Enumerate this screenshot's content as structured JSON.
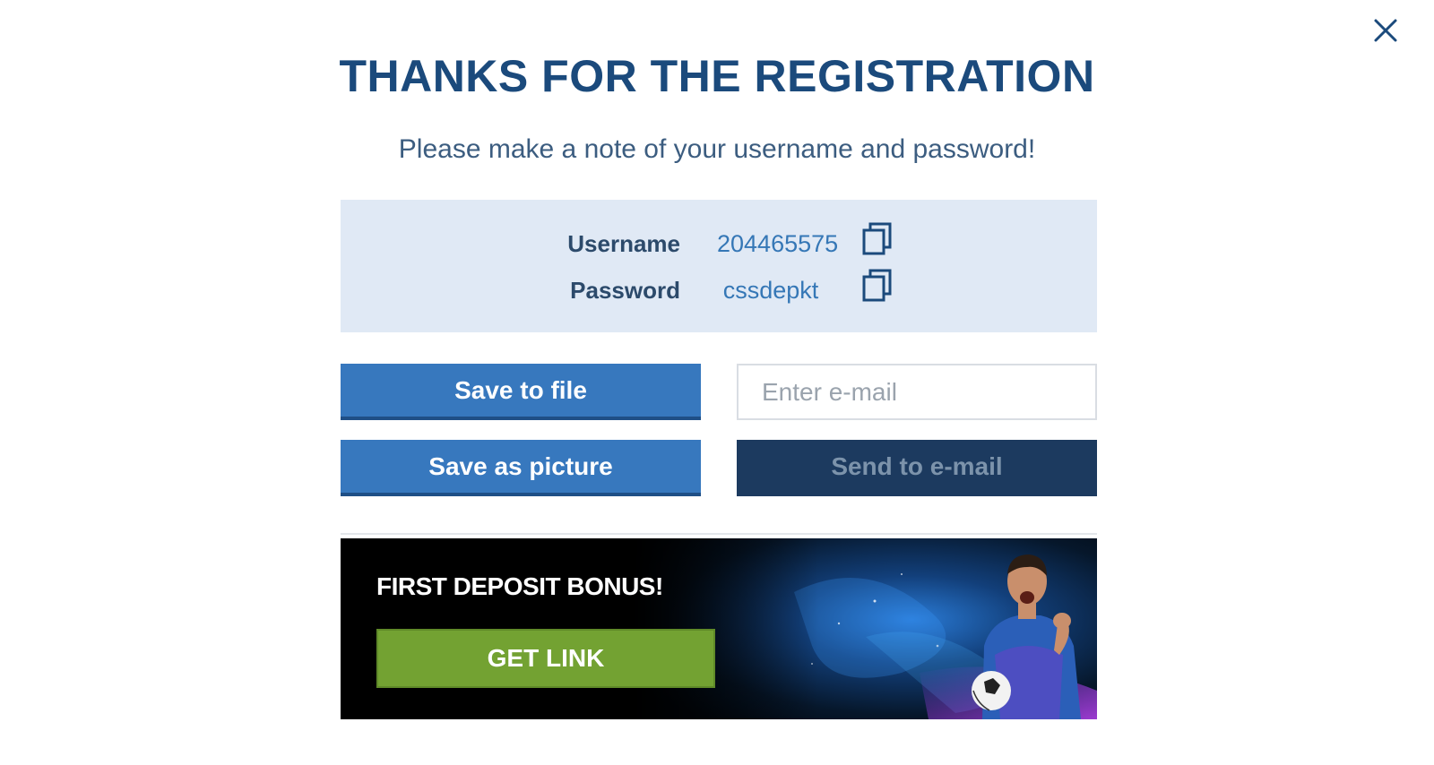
{
  "dialog": {
    "title": "THANKS FOR THE REGISTRATION",
    "subtitle": "Please make a note of your username and password!",
    "close_icon": "close-icon"
  },
  "credentials": {
    "username_label": "Username",
    "username_value": "204465575",
    "password_label": "Password",
    "password_value": "cssdepkt",
    "copy_icon": "copy-icon"
  },
  "actions": {
    "save_to_file": "Save to file",
    "save_as_picture": "Save as picture",
    "email_placeholder": "Enter e-mail",
    "send_to_email": "Send to e-mail"
  },
  "banner": {
    "title": "FIRST DEPOSIT BONUS!",
    "button": "GET LINK"
  },
  "colors": {
    "title": "#1b4a7c",
    "primary_button": "#3778be",
    "send_button": "#1c3a5f",
    "credentials_bg": "#e0e9f5",
    "get_link_button": "#73a232"
  }
}
